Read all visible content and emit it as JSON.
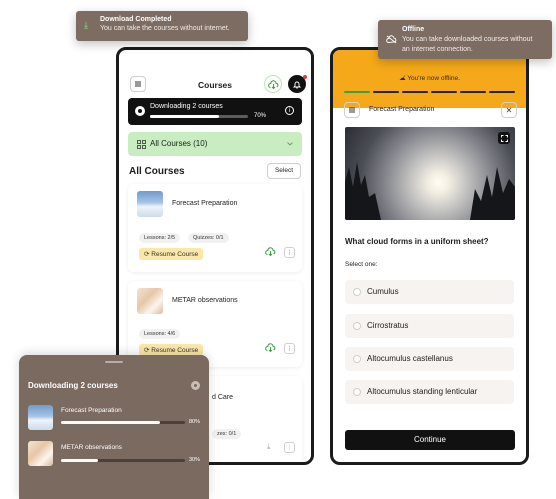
{
  "toast_download": {
    "title": "Download Completed",
    "message": "You can take the courses without internet."
  },
  "toast_offline": {
    "title": "Offline",
    "message_line1": "You can take downloaded courses without",
    "message_line2": "an internet connection."
  },
  "left_phone": {
    "title": "Courses",
    "downloading": {
      "label": "Downloading 2 courses",
      "percent_label": "70%",
      "progress": 0.7
    },
    "filter": {
      "label": "All Courses (10)"
    },
    "section_title": "All Courses",
    "select_label": "Select",
    "courses": [
      {
        "title": "Forecast Preparation",
        "lessons": "Lessons: 2/5",
        "quizzes": "Quizzes: 0/1",
        "resume_label": "Resume Course"
      },
      {
        "title": "METAR observations",
        "lessons": "Lessons: 4/6",
        "resume_label": "Resume Course"
      },
      {
        "title_fragment": "d Care",
        "quizzes_fragment": "zes: 0/1"
      }
    ]
  },
  "right_phone": {
    "offline_banner": "You're now offline.",
    "header_title": "Forecast Preparation",
    "question": "What cloud forms in a uniform sheet?",
    "prompt": "Select one:",
    "options": [
      "Cumulus",
      "Cirrostratus",
      "Altocumulus castellanus",
      "Altocumulus standing lenticular"
    ],
    "continue_label": "Continue",
    "progress_segments": 6,
    "progress_completed": 1
  },
  "downloads_panel": {
    "title": "Downloading 2 courses",
    "items": [
      {
        "title": "Forecast Preparation",
        "percent_label": "80%",
        "progress": 0.8
      },
      {
        "title": "METAR observations",
        "percent_label": "30%",
        "progress": 0.3
      }
    ]
  },
  "colors": {
    "accent_green": "#3aa141",
    "offline_orange": "#f5a91a",
    "toast_brown": "#7d6c62",
    "resume_yellow": "#fbe7a8",
    "filter_green": "#c8edc0"
  },
  "icons": {
    "download_complete": "download-check-icon",
    "offline": "cloud-off-icon",
    "menu": "menu-icon",
    "cloud_download": "cloud-download-icon",
    "bell": "bell-icon",
    "grid": "grid-icon",
    "chevron": "chevron-down-icon",
    "resume": "refresh-icon",
    "more": "more-vertical-icon",
    "close": "close-icon",
    "expand": "expand-icon",
    "info": "info-icon"
  }
}
